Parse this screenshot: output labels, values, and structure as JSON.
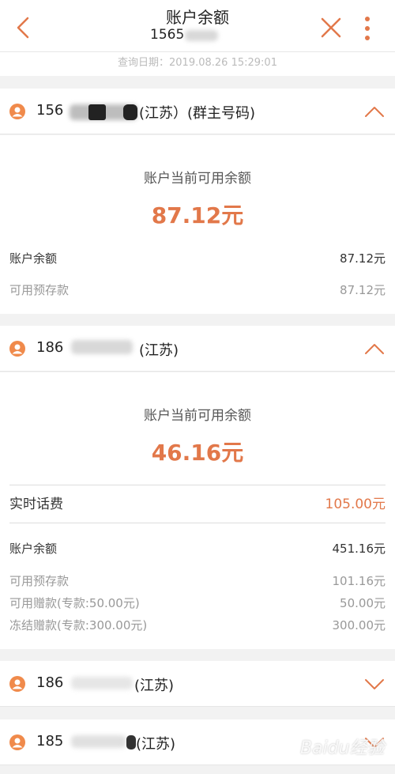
{
  "header": {
    "title": "账户余额",
    "subtitle": "1565"
  },
  "query_date": "查询日期：2019.08.26 15:29:01",
  "accounts": [
    {
      "number": "156",
      "region": "(江苏）(群主号码)",
      "balance_label": "账户当前可用余额",
      "balance": "87.12元",
      "rows": [
        {
          "label": "账户余额",
          "value": "87.12元"
        },
        {
          "label": "可用预存款",
          "value": "87.12元"
        }
      ]
    },
    {
      "number": "186",
      "region": "(江苏)",
      "balance_label": "账户当前可用余额",
      "balance": "46.16元",
      "realtime": {
        "label": "实时话费",
        "value": "105.00元"
      },
      "rows": [
        {
          "label": "账户余额",
          "value": "451.16元"
        },
        {
          "label": "可用预存款",
          "value": "101.16元"
        },
        {
          "label": "可用赠款(专款:50.00元)",
          "value": "50.00元"
        },
        {
          "label": "冻结赠款(专款:300.00元)",
          "value": "300.00元"
        }
      ]
    },
    {
      "number": "186",
      "region": "(江苏)"
    },
    {
      "number": "185",
      "region": "(江苏)"
    }
  ],
  "watermark": "Baidu经验",
  "colors": {
    "accent": "#e2784a",
    "avatar": "#f08a4b"
  }
}
